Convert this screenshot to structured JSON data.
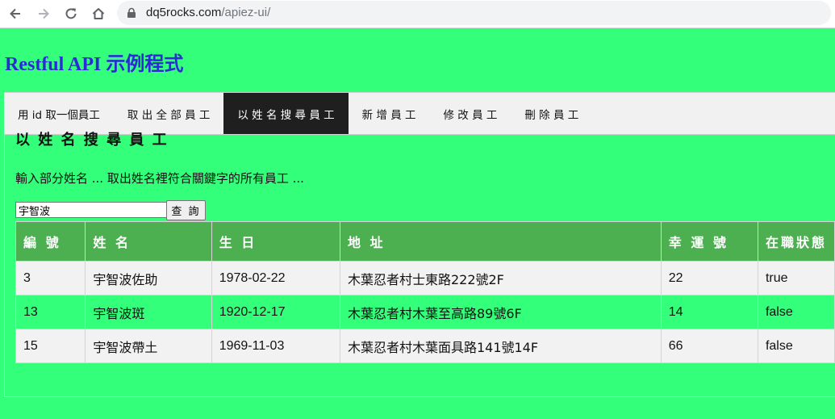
{
  "browser": {
    "url_domain": "dq5rocks.com",
    "url_path": "/apiez-ui/"
  },
  "app": {
    "title": "Restful API 示例程式"
  },
  "tabs": [
    {
      "label": "用 id 取一個員工",
      "active": false
    },
    {
      "label": "取 出 全 部 員 工",
      "active": false
    },
    {
      "label": "以 姓 名 搜 尋 員 工",
      "active": true
    },
    {
      "label": "新 增 員 工",
      "active": false
    },
    {
      "label": "修 改 員 工",
      "active": false
    },
    {
      "label": "刪 除 員 工",
      "active": false
    }
  ],
  "section": {
    "title": "以 姓 名 搜 尋 員 工",
    "description": "輸入部分姓名 ... 取出姓名裡符合關鍵字的所有員工 ..."
  },
  "search": {
    "value": "宇智波",
    "button_label": "查 詢"
  },
  "table": {
    "headers": [
      "編 號",
      "姓 名",
      "生 日",
      "地 址",
      "幸 運 號",
      "在職狀態"
    ],
    "rows": [
      [
        "3",
        "宇智波佐助",
        "1978-02-22",
        "木葉忍者村士東路222號2F",
        "22",
        "true"
      ],
      [
        "13",
        "宇智波斑",
        "1920-12-17",
        "木葉忍者村木葉至高路89號6F",
        "14",
        "false"
      ],
      [
        "15",
        "宇智波帶土",
        "1969-11-03",
        "木葉忍者村木葉面具路141號14F",
        "66",
        "false"
      ]
    ]
  },
  "colors": {
    "page_background": "#33ff7a",
    "title": "#2b2bd6",
    "tab_active_background": "#1f1f1f",
    "table_header": "#4caf50",
    "row_odd": "#f2f2f2"
  },
  "icons": [
    "back-icon",
    "forward-icon",
    "reload-icon",
    "home-icon",
    "lock-icon"
  ]
}
